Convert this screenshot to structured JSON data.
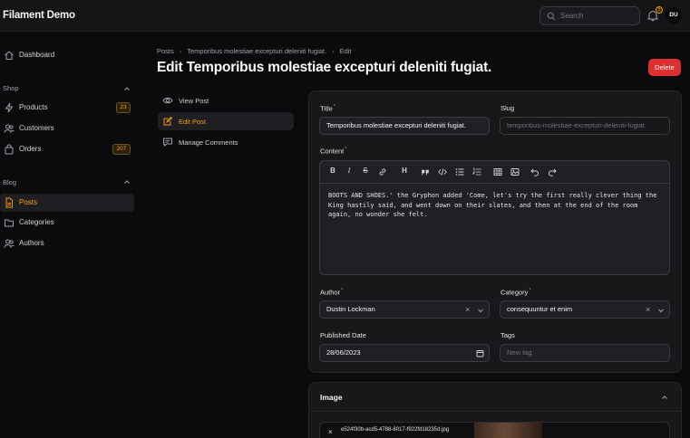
{
  "app": {
    "brand": "Filament Demo"
  },
  "topbar": {
    "search_placeholder": "Search",
    "notification_count": "5",
    "avatar_initials": "DU"
  },
  "sidebar": {
    "dashboard": "Dashboard",
    "shop_group": "Shop",
    "products": "Products",
    "products_count": "23",
    "customers": "Customers",
    "orders": "Orders",
    "orders_count": "207",
    "blog_group": "Blog",
    "posts": "Posts",
    "categories": "Categories",
    "authors": "Authors"
  },
  "breadcrumb": {
    "posts": "Posts",
    "record": "Temporibus molestiae excepturi deleniti fugiat.",
    "current": "Edit"
  },
  "page": {
    "title": "Edit Temporibus molestiae excepturi deleniti fugiat.",
    "delete_label": "Delete"
  },
  "subnav": {
    "view": "View Post",
    "edit": "Edit Post",
    "comments": "Manage Comments"
  },
  "form": {
    "title_label": "Title",
    "title_value": "Temporibus molestiae excepturi deleniti fugiat.",
    "slug_label": "Slug",
    "slug_value": "temporibus-molestiae-excepturi-deleniti-fugiat",
    "content_label": "Content",
    "content_value": "BOOTS AND SHOES.' the Gryphon added 'Come, let's try the first really clever thing the King hastily said, and went down on their slates, and then at the end of the room again, no wonder she felt.",
    "author_label": "Author",
    "author_value": "Dustin Lockman",
    "category_label": "Category",
    "category_value": "consequuntur et enim",
    "published_label": "Published Date",
    "published_value": "28/06/2023",
    "tags_label": "Tags",
    "tags_placeholder": "New tag"
  },
  "toolbar": {
    "bold": "B",
    "italic": "I",
    "strike": "S",
    "heading": "H"
  },
  "image_section": {
    "title": "Image",
    "file_name": "e524f30b-acd5-4788-8017-f922fd18235d.jpg"
  },
  "colors": {
    "accent": "#f59e0b",
    "danger": "#dc2f2f",
    "background": "#0b0b0d",
    "card": "#18181b"
  }
}
